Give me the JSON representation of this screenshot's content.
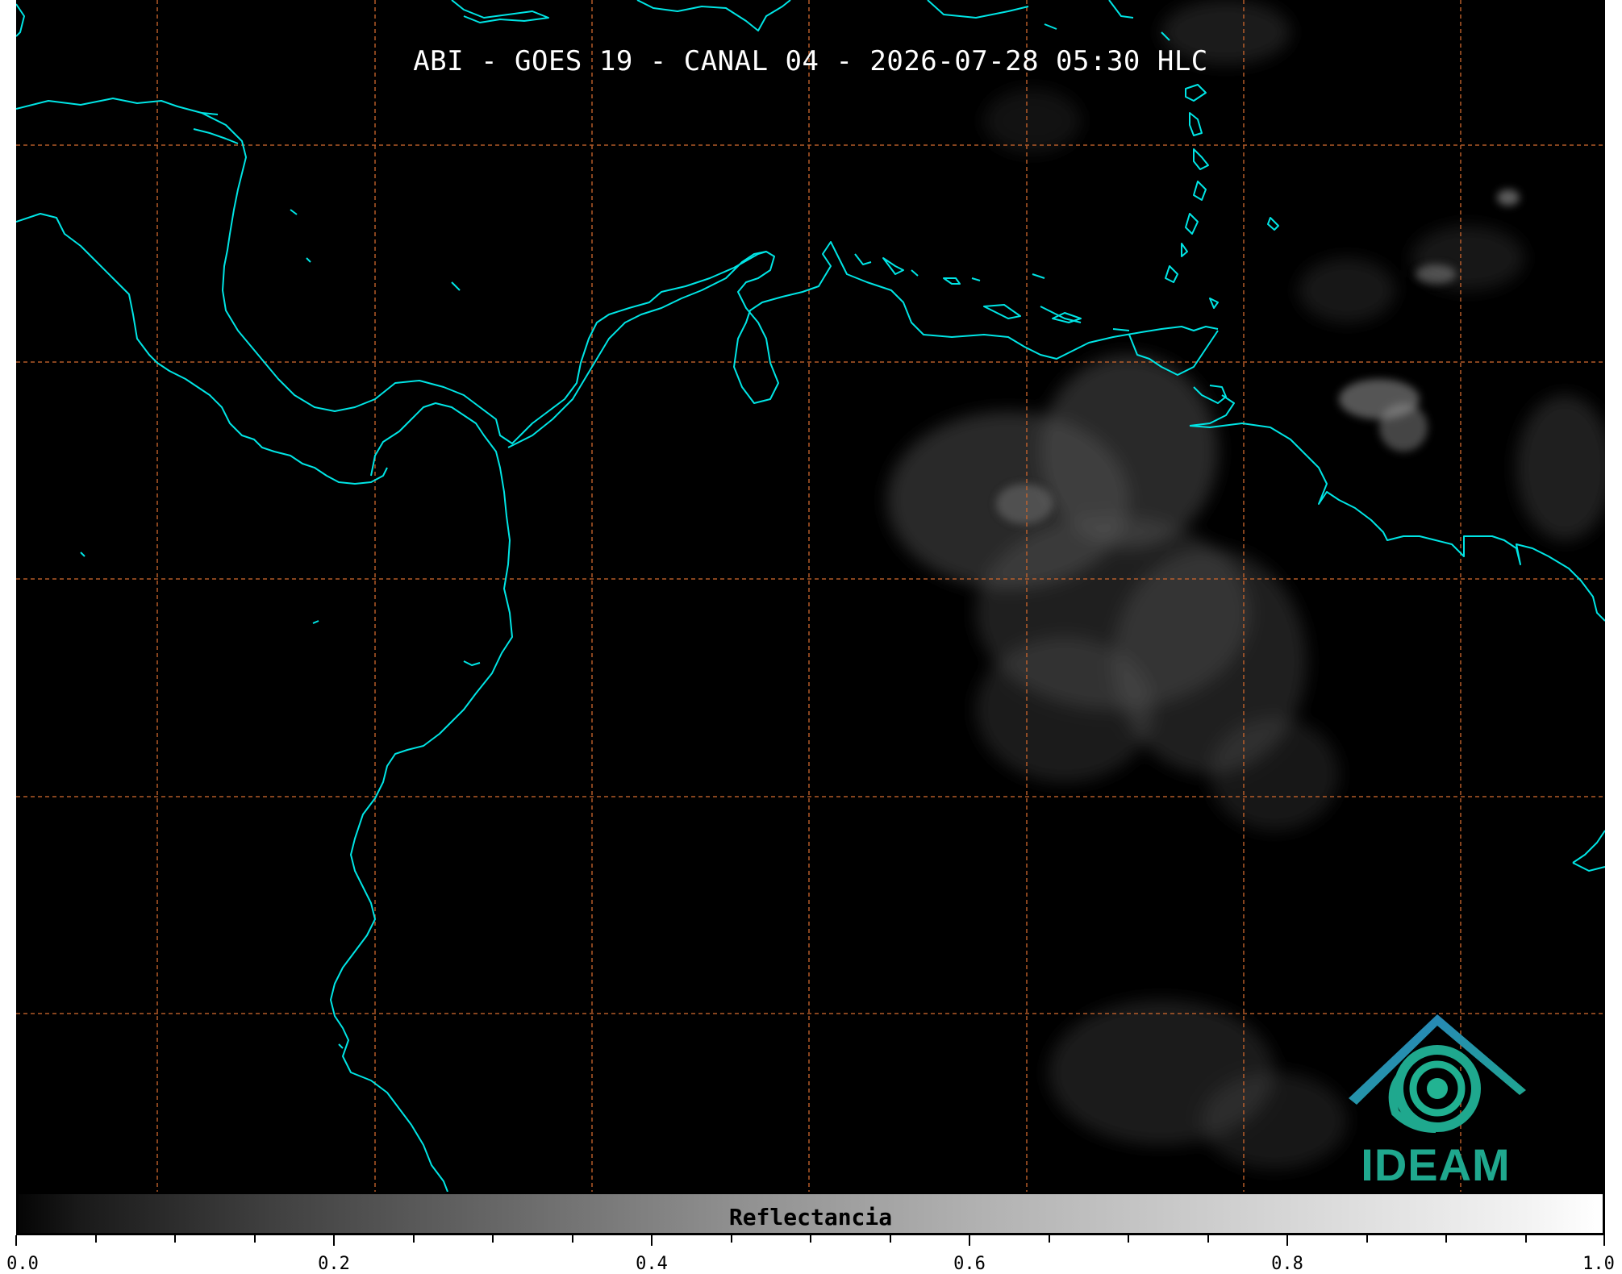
{
  "map": {
    "title": "ABI - GOES 19 - CANAL 04 - 2026-07-28 05:30 HLC",
    "colors": {
      "background": "#000000",
      "coastline": "#00e5e5",
      "graticule": "#c8642d",
      "cloud": "#6a6a6a"
    }
  },
  "logo": {
    "text": "IDEAM",
    "icon": "ideam-logo-icon",
    "colors": {
      "roof": "#2a7fc4",
      "swirl": "#1fa88e"
    }
  },
  "colorbar": {
    "label": "Reflectancia",
    "min": 0.0,
    "max": 1.0,
    "major_ticks": [
      "0.0",
      "0.2",
      "0.4",
      "0.6",
      "0.8",
      "1.0"
    ],
    "minor_step": 0.05
  }
}
